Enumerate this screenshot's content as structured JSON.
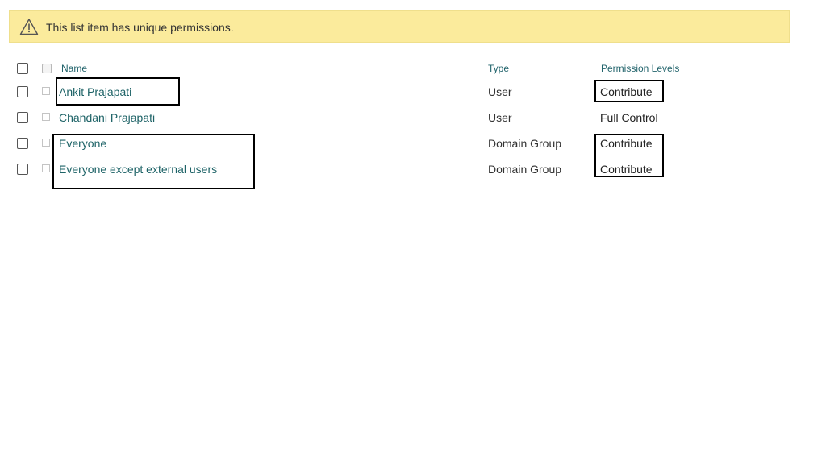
{
  "banner": {
    "icon": "warning-icon",
    "message": "This list item has unique permissions.",
    "background": "#fbeb9c"
  },
  "table": {
    "headers": {
      "name": "Name",
      "type": "Type",
      "permission_levels": "Permission Levels"
    },
    "rows": [
      {
        "name": "Ankit Prajapati",
        "type": "User",
        "permission": "Contribute"
      },
      {
        "name": "Chandani Prajapati",
        "type": "User",
        "permission": "Full Control"
      },
      {
        "name": "Everyone",
        "type": "Domain Group",
        "permission": "Contribute"
      },
      {
        "name": "Everyone except external users",
        "type": "Domain Group",
        "permission": "Contribute"
      }
    ]
  },
  "colors": {
    "link": "#1e6367",
    "header_text": "#21636b",
    "body_text": "#333333"
  }
}
